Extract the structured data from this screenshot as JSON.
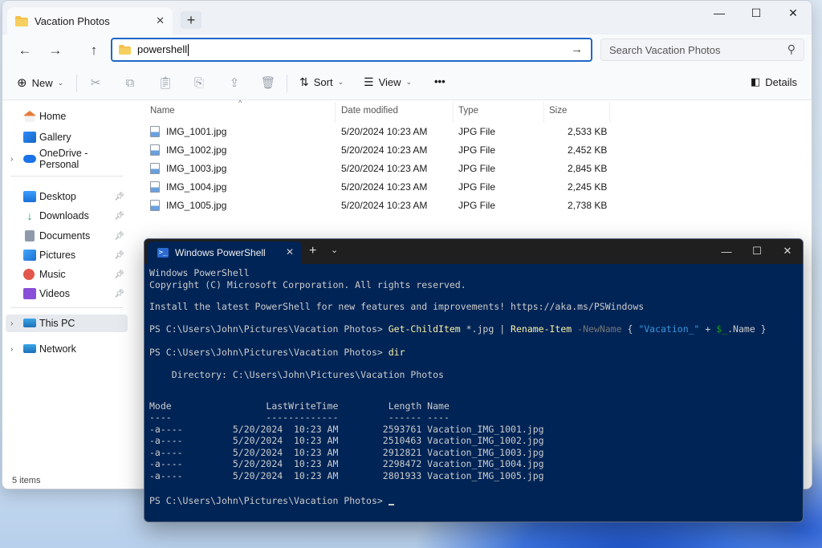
{
  "explorer": {
    "tab_title": "Vacation Photos",
    "address_value": "powershell",
    "search_placeholder": "Search Vacation Photos",
    "commands": {
      "new_label": "New",
      "sort_label": "Sort",
      "view_label": "View",
      "more_label": "•••",
      "details_label": "Details"
    },
    "sidebar": {
      "items": [
        {
          "label": "Home"
        },
        {
          "label": "Gallery"
        },
        {
          "label": "OneDrive - Personal"
        },
        {
          "label": "Desktop"
        },
        {
          "label": "Downloads"
        },
        {
          "label": "Documents"
        },
        {
          "label": "Pictures"
        },
        {
          "label": "Music"
        },
        {
          "label": "Videos"
        },
        {
          "label": "This PC"
        },
        {
          "label": "Network"
        }
      ]
    },
    "columns": {
      "name": "Name",
      "date": "Date modified",
      "type": "Type",
      "size": "Size"
    },
    "files": [
      {
        "name": "IMG_1001.jpg",
        "date": "5/20/2024 10:23 AM",
        "type": "JPG File",
        "size": "2,533 KB"
      },
      {
        "name": "IMG_1002.jpg",
        "date": "5/20/2024 10:23 AM",
        "type": "JPG File",
        "size": "2,452 KB"
      },
      {
        "name": "IMG_1003.jpg",
        "date": "5/20/2024 10:23 AM",
        "type": "JPG File",
        "size": "2,845 KB"
      },
      {
        "name": "IMG_1004.jpg",
        "date": "5/20/2024 10:23 AM",
        "type": "JPG File",
        "size": "2,245 KB"
      },
      {
        "name": "IMG_1005.jpg",
        "date": "5/20/2024 10:23 AM",
        "type": "JPG File",
        "size": "2,738 KB"
      }
    ],
    "status": "5 items"
  },
  "terminal": {
    "tab_title": "Windows PowerShell",
    "line_banner": "Windows PowerShell",
    "line_copyright": "Copyright (C) Microsoft Corporation. All rights reserved.",
    "line_install": "Install the latest PowerShell for new features and improvements! https://aka.ms/PSWindows",
    "prompt": "PS C:\\Users\\John\\Pictures\\Vacation Photos> ",
    "cmd1": {
      "cmdlet1": "Get-ChildItem",
      "arg1": " *.jpg | ",
      "cmdlet2": "Rename-Item",
      "param": " -NewName",
      "brace_open": " { ",
      "string": "\"Vacation_\"",
      "plus": " + ",
      "var": "$_",
      "prop": ".Name }"
    },
    "cmd2": "dir",
    "directory_line": "    Directory: C:\\Users\\John\\Pictures\\Vacation Photos",
    "header_line": "Mode                 LastWriteTime         Length Name",
    "underline_line": "----                 -------------         ------ ----",
    "rows": [
      "-a----         5/20/2024  10:23 AM        2593761 Vacation_IMG_1001.jpg",
      "-a----         5/20/2024  10:23 AM        2510463 Vacation_IMG_1002.jpg",
      "-a----         5/20/2024  10:23 AM        2912821 Vacation_IMG_1003.jpg",
      "-a----         5/20/2024  10:23 AM        2298472 Vacation_IMG_1004.jpg",
      "-a----         5/20/2024  10:23 AM        2801933 Vacation_IMG_1005.jpg"
    ],
    "final_prompt": "PS C:\\Users\\John\\Pictures\\Vacation Photos> "
  },
  "colors": {
    "terminal_bg": "#012456",
    "cmdlet_yellow": "#f9f1a5",
    "string_blue": "#3a96dd",
    "variable_green": "#13a10e",
    "accent": "#1f67c8"
  }
}
